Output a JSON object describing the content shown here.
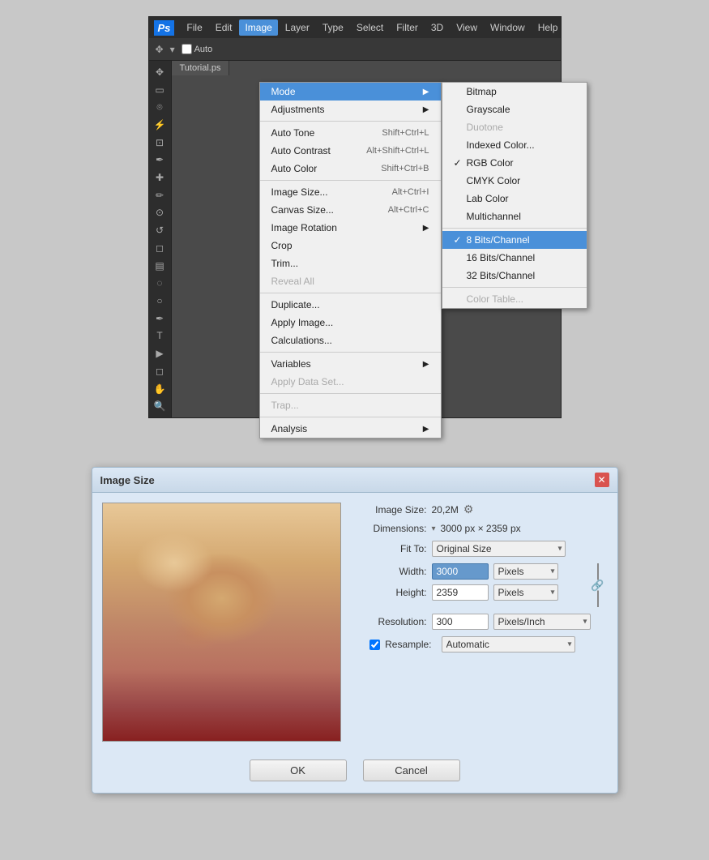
{
  "ps": {
    "logo": "Ps",
    "menubar": {
      "items": [
        "File",
        "Edit",
        "Image",
        "Layer",
        "Type",
        "Select",
        "Filter",
        "3D",
        "View",
        "Window",
        "Help"
      ]
    },
    "active_menu": "Image",
    "toolbar": {
      "auto_label": "Auto"
    },
    "tab_label": "Tutorial.ps",
    "image_menu": {
      "items": [
        {
          "label": "Mode",
          "shortcut": "",
          "arrow": true,
          "highlighted": true
        },
        {
          "label": "Adjustments",
          "shortcut": "",
          "arrow": true
        },
        {
          "sep": true
        },
        {
          "label": "Auto Tone",
          "shortcut": "Shift+Ctrl+L"
        },
        {
          "label": "Auto Contrast",
          "shortcut": "Alt+Shift+Ctrl+L"
        },
        {
          "label": "Auto Color",
          "shortcut": "Shift+Ctrl+B"
        },
        {
          "sep": true
        },
        {
          "label": "Image Size...",
          "shortcut": "Alt+Ctrl+I"
        },
        {
          "label": "Canvas Size...",
          "shortcut": "Alt+Ctrl+C"
        },
        {
          "label": "Image Rotation",
          "shortcut": "",
          "arrow": true
        },
        {
          "label": "Crop",
          "shortcut": ""
        },
        {
          "label": "Trim...",
          "shortcut": ""
        },
        {
          "label": "Reveal All",
          "shortcut": "",
          "disabled": true
        },
        {
          "sep": true
        },
        {
          "label": "Duplicate...",
          "shortcut": ""
        },
        {
          "label": "Apply Image...",
          "shortcut": ""
        },
        {
          "label": "Calculations...",
          "shortcut": ""
        },
        {
          "sep": true
        },
        {
          "label": "Variables",
          "shortcut": "",
          "arrow": true
        },
        {
          "label": "Apply Data Set...",
          "shortcut": "",
          "disabled": true
        },
        {
          "sep": true
        },
        {
          "label": "Trap...",
          "shortcut": "",
          "disabled": true
        },
        {
          "sep": true
        },
        {
          "label": "Analysis",
          "shortcut": "",
          "arrow": true
        }
      ]
    },
    "mode_submenu": {
      "items": [
        {
          "label": "Bitmap",
          "check": false
        },
        {
          "label": "Grayscale",
          "check": false
        },
        {
          "label": "Duotone",
          "check": false,
          "disabled": true
        },
        {
          "label": "Indexed Color...",
          "check": false
        },
        {
          "label": "RGB Color",
          "check": true
        },
        {
          "label": "CMYK Color",
          "check": false
        },
        {
          "label": "Lab Color",
          "check": false
        },
        {
          "label": "Multichannel",
          "check": false
        },
        {
          "sep": true
        },
        {
          "label": "8 Bits/Channel",
          "check": true,
          "highlighted": true
        },
        {
          "label": "16 Bits/Channel",
          "check": false
        },
        {
          "label": "32 Bits/Channel",
          "check": false
        },
        {
          "sep": true
        },
        {
          "label": "Color Table...",
          "check": false,
          "disabled": true
        }
      ]
    }
  },
  "image_size_dialog": {
    "title": "Image Size",
    "close_btn": "✕",
    "fields": {
      "image_size_label": "Image Size:",
      "image_size_value": "20,2M",
      "dimensions_label": "Dimensions:",
      "dimensions_value": "3000 px × 2359 px",
      "fit_to_label": "Fit To:",
      "fit_to_value": "Original Size",
      "width_label": "Width:",
      "width_value": "3000",
      "width_unit": "Pixels",
      "height_label": "Height:",
      "height_value": "2359",
      "height_unit": "Pixels",
      "resolution_label": "Resolution:",
      "resolution_value": "300",
      "resolution_unit": "Pixels/Inch",
      "resample_label": "Resample:",
      "resample_value": "Automatic"
    },
    "buttons": {
      "ok": "OK",
      "cancel": "Cancel"
    }
  }
}
